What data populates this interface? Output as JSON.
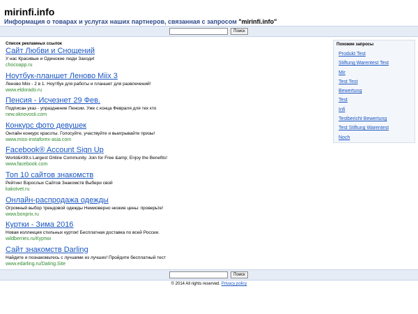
{
  "header": {
    "site_title": "mirinfi.info",
    "subtitle_prefix": "Информация о товарах и услугах наших партнеров, связанная с запросом ",
    "subtitle_query": "\"mirinfi.info\""
  },
  "search": {
    "button_label": "Поиск",
    "input_value": ""
  },
  "ads": {
    "header": "Список рекламных ссылок",
    "items": [
      {
        "title": "Сайт Любви и Снощений",
        "desc": "У нас Красивые и Одинокие люди Заходи!",
        "url": "chocoapp.ru"
      },
      {
        "title": "Ноутбук-планшет Леново Miix 3",
        "desc": "Леново Miix - 2 в 1. Ноутбук для работы и планшет для развлечений!",
        "url": "www.eldorado.ru"
      },
      {
        "title": "Пенсия - Исчезнет 29 Фев.",
        "desc": "Подписан указ - упразднение Пенсии. Уже с конца Февраля для тех кто",
        "url": "new.oknovosti.com"
      },
      {
        "title": "Конкурс фото девушек",
        "desc": "Онлайн конкурс красоты. Голосуйте, участвуйте и выигрывайте призы!",
        "url": "www.miss-instaforex-asia.com"
      },
      {
        "title": "Facebook® Account Sign Up",
        "desc": "World&#39;s Largest Online Community. Join for Free &amp; Enjoy the Benefits!",
        "url": "www.facebook.com"
      },
      {
        "title": "Топ 10 сайтов знакомств",
        "desc": "Рейтинг Взрослых Сайтов Знакомств Выбери свой",
        "url": "kakotvet.ru"
      },
      {
        "title": "Онлайн-распродажа одежды",
        "desc": "Огромный выбор трендовой одежды Немиоверно низкие цены: проверьте!",
        "url": "www.bonprix.ru"
      },
      {
        "title": "Куртки - Зима 2016",
        "desc": "Новая коллекция стильных курток! Бесплатная доставка по всей России.",
        "url": "wildberries.ru/Куртки"
      },
      {
        "title": "Сайт знакомств Darling",
        "desc": "Найдите и познакомьтесь с лучшими из лучших! Пройдите бесплатный тест",
        "url": "www.edarling.ru/Dating.Site"
      }
    ]
  },
  "related": {
    "header": "Похожие запросы",
    "items": [
      "Produkt Test",
      "Stiftung Warentest Test",
      "Mir",
      "Test Test",
      "Bewertung",
      "Test",
      "Infi",
      "Testbericht Bewertung",
      "Test Stiftung Warentest",
      "Noch"
    ]
  },
  "footer": {
    "copyright": "© 2014 All rights reserved.",
    "privacy": "Privacy policy"
  },
  "colors": {
    "link": "#1a56c2",
    "url_green": "#2c8a2c",
    "subtitle": "#2f4a8a",
    "bar_bg": "#e6ecf6"
  }
}
